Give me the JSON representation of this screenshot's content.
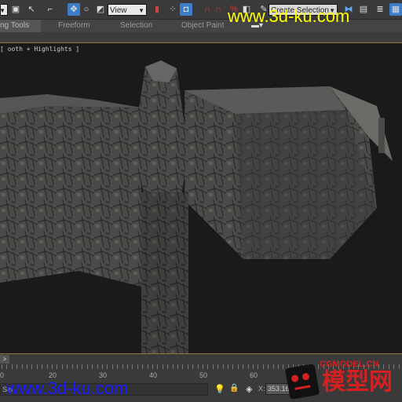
{
  "toolbar": {
    "view_select": "View",
    "selection_set": "Create Selection Se"
  },
  "ribbon": {
    "tabs": [
      "ng Tools",
      "Freeform",
      "Selection",
      "Object Paint"
    ]
  },
  "viewport": {
    "label": "[ ooth + Highlights ]"
  },
  "timeline": {
    "next_label": ">",
    "ticks": [
      "0",
      "20",
      "30",
      "40",
      "50",
      "60"
    ]
  },
  "status": {
    "selected_text": "Sel",
    "x_label": "X:",
    "x_value": "353.16"
  },
  "watermarks": {
    "top": "www.3d-ku.com",
    "bottom": "www.3d-ku.com",
    "logo_top": "CGMODEL.CN",
    "logo_main": "模型网"
  },
  "colors": {
    "accent": "#3d7cc9",
    "watermark_yellow": "#ffff00",
    "watermark_blue": "#1a1aff",
    "logo_red": "#d42020"
  }
}
